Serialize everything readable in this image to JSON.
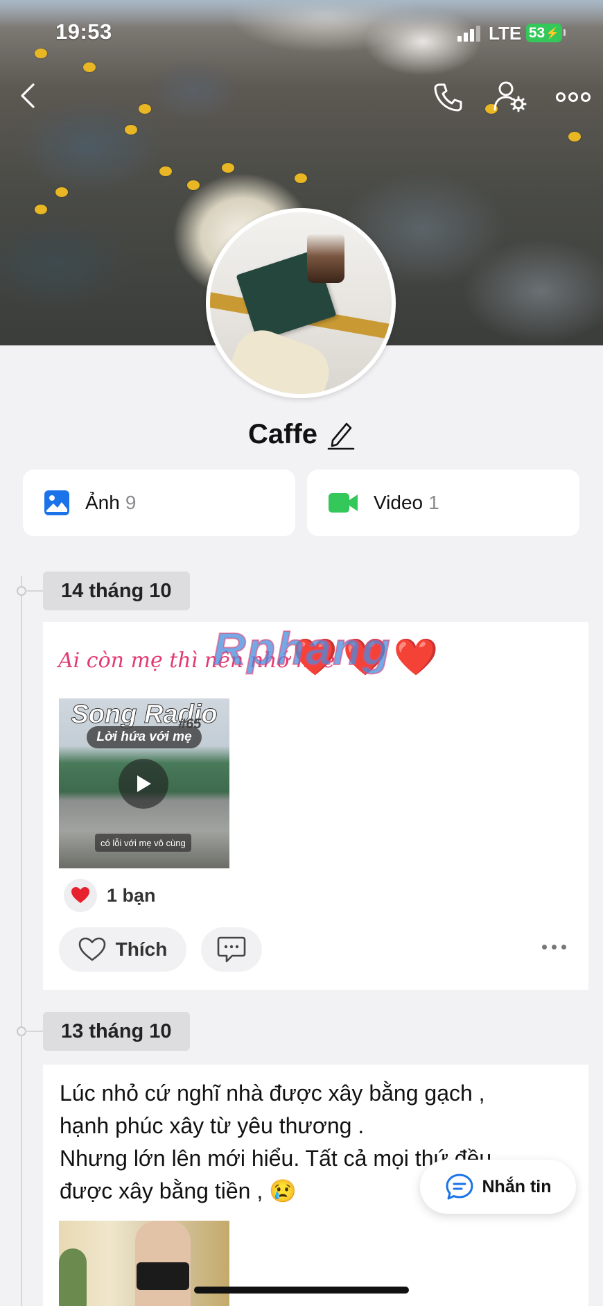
{
  "status_bar": {
    "time": "19:53",
    "network": "LTE",
    "battery": "53"
  },
  "header": {
    "back_icon": "chevron-left-icon",
    "call_icon": "phone-icon",
    "profile_settings_icon": "person-gear-icon",
    "more_icon": "more-horizontal-icon"
  },
  "profile": {
    "name": "Caffe",
    "edit_icon": "pencil-icon"
  },
  "media": {
    "photos": {
      "label": "Ảnh",
      "count": "9",
      "icon": "image-icon",
      "color": "#1a73e8"
    },
    "videos": {
      "label": "Video",
      "count": "1",
      "icon": "video-camera-icon",
      "color": "#34c759"
    }
  },
  "timeline": [
    {
      "date": "14 tháng 10",
      "post": {
        "caption": "Ai còn mẹ thì nên nhớ nhé",
        "emojis": "❤️❤️❤️",
        "watermark": "Rphang",
        "video": {
          "title": "Song Radio",
          "episode": "#65",
          "subtitle": "Lời hứa với mẹ",
          "caption": "có lỗi với mẹ vô cùng"
        },
        "reaction_summary": "1 bạn",
        "like_label": "Thích"
      }
    },
    {
      "date": "13 tháng 10",
      "post": {
        "lines": [
          "Lúc nhỏ cứ nghĩ nhà được xây bằng gạch ,",
          "hạnh phúc xây từ yêu thương .",
          "Nhưng lớn lên mới hiểu. Tất cả mọi thứ đều",
          "được xây bằng tiền , 😢"
        ]
      }
    }
  ],
  "fab": {
    "label": "Nhắn tin",
    "icon": "chat-bubble-icon"
  },
  "colors": {
    "accent_blue": "#1a73e8",
    "accent_green": "#34c759",
    "caption_pink": "#e23b72",
    "heart_red": "#e8212e"
  }
}
